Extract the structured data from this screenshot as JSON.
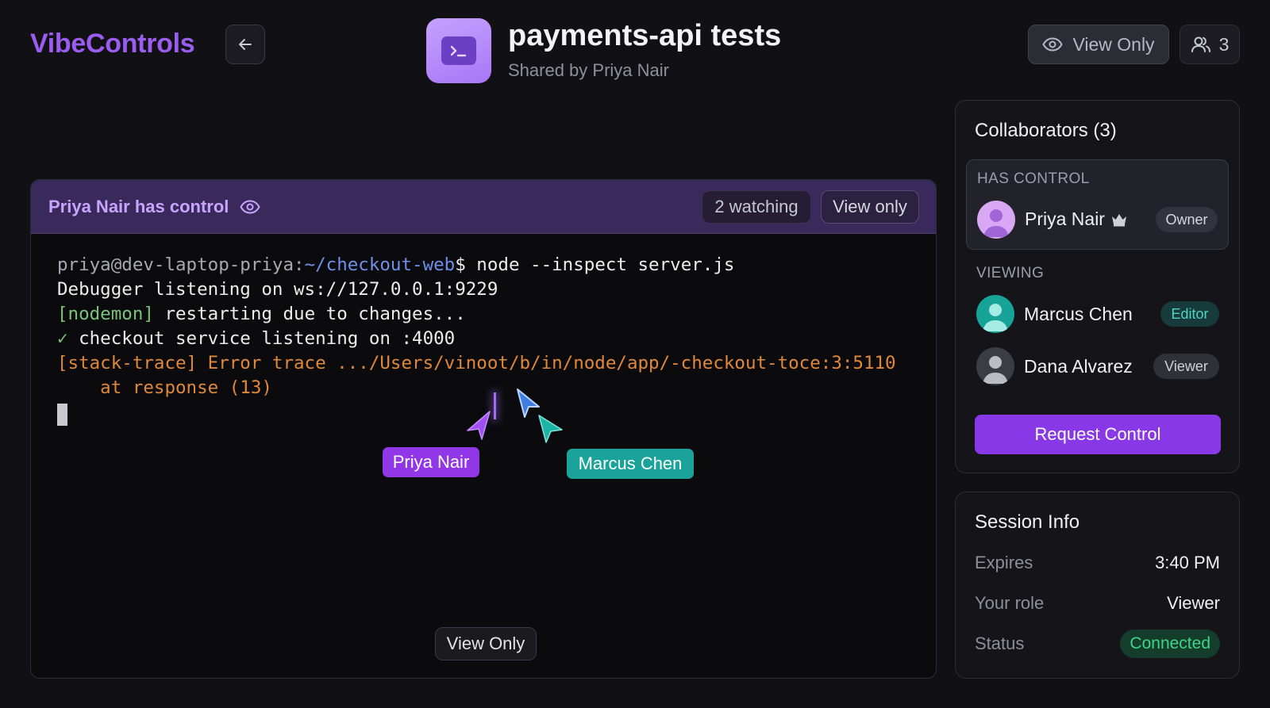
{
  "brand": "VibeControls",
  "header": {
    "title": "payments-api tests",
    "subtitle": "Shared by Priya Nair",
    "view_only_label": "View Only",
    "user_count": "3"
  },
  "terminal": {
    "control_text": "Priya Nair has control",
    "watching": "2 watching",
    "view_only_pill": "View only",
    "prompt_user": "priya@dev-laptop-priya:",
    "prompt_path": "~/checkout-web",
    "prompt_cmd": "$ node --inspect server.js",
    "line2": "Debugger listening on ws://127.0.0.1:9229",
    "line3_tag": "[nodemon]",
    "line3_rest": " restarting due to changes...",
    "line4_check": "✓",
    "line4_rest": " checkout service listening on :4000",
    "line5": "[stack-trace] Error trace .../Users/vinoot/b/in/node/app/-checkout-toce:3:5110",
    "line6": "    at response (13)",
    "cursor_priya": "Priya Nair",
    "cursor_marcus": "Marcus Chen",
    "bottom_view_only": "View Only"
  },
  "collaborators": {
    "title": "Collaborators (3)",
    "has_control_label": "HAS CONTROL",
    "viewing_label": "VIEWING",
    "owner": {
      "name": "Priya Nair",
      "role": "Owner"
    },
    "viewers": [
      {
        "name": "Marcus Chen",
        "role": "Editor"
      },
      {
        "name": "Dana Alvarez",
        "role": "Viewer"
      }
    ],
    "request_button": "Request Control"
  },
  "session": {
    "title": "Session Info",
    "rows": [
      {
        "key": "Expires",
        "value": "3:40 PM"
      },
      {
        "key": "Your role",
        "value": "Viewer"
      },
      {
        "key": "Status",
        "value": "Connected"
      }
    ]
  },
  "colors": {
    "accent": "#8838e6",
    "brand": "#9b5cf0",
    "teal": "#1aa39a",
    "connected": "#3fd488"
  },
  "icons": [
    "arrow-left-icon",
    "terminal-icon",
    "eye-icon",
    "users-icon",
    "crown-icon",
    "cursor-icon"
  ]
}
